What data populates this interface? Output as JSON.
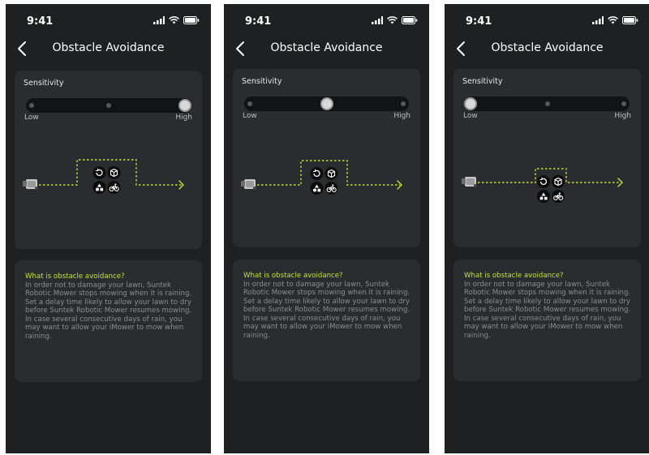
{
  "status_time": "9:41",
  "nav_title": "Obstacle Avoidance",
  "sensitivity_label": "Sensitivity",
  "low_label": "Low",
  "high_label": "High",
  "info": {
    "question": "What is obstacle avoidance?",
    "lines": [
      "In order not to damage your lawn, Suntek Robotic Mower stops mowing when it is raining.",
      "Set a delay time likely to allow your lawn to dry before Suntek Robotic Mower resumes mowing.",
      "In case several consecutive days of rain, you may want to allow your iMower to mow when raining."
    ]
  },
  "screens": [
    {
      "sensitivity": "High",
      "slider_level": 1.0
    },
    {
      "sensitivity": "Medium",
      "slider_level": 0.5
    },
    {
      "sensitivity": "Low",
      "slider_level": 0.0
    }
  ],
  "colors": {
    "background": "#1f2022",
    "card": "#2b2c2f",
    "accent": "#c3e134",
    "text": "#ffffff",
    "muted_text": "#8c8d90"
  },
  "icons": [
    "back-arrow-icon",
    "signal-icon",
    "wifi-icon",
    "battery-icon",
    "mower-icon",
    "rotate-icon",
    "box-icon",
    "obstacle-shapes-icon",
    "bicycle-icon",
    "arrow-right-icon"
  ]
}
